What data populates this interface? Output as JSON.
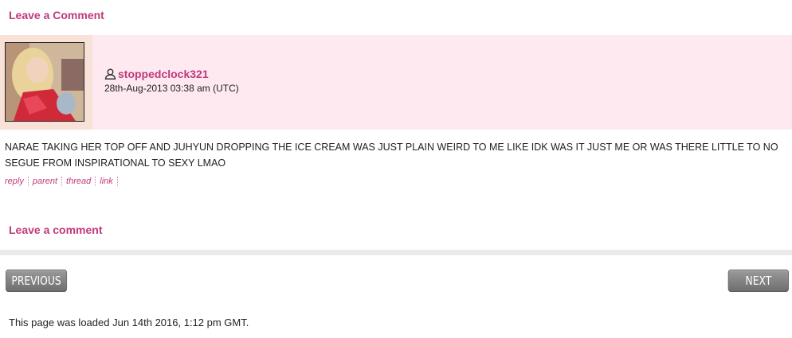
{
  "leave_comment_top": "Leave a Comment",
  "comment": {
    "username": "stoppedclock321",
    "timestamp": "28th-Aug-2013 03:38 am (UTC)",
    "body": "NARAE TAKING HER TOP OFF AND JUHYUN DROPPING THE ICE CREAM WAS JUST PLAIN WEIRD TO ME LIKE IDK WAS IT JUST ME OR WAS THERE LITTLE TO NO SEGUE FROM INSPIRATIONAL TO SEXY LMAO",
    "links": {
      "reply": "reply",
      "parent": "parent",
      "thread": "thread",
      "link": "link"
    },
    "user_icon": "user-icon",
    "header_bg": "#ffe9f1"
  },
  "leave_comment_bottom": "Leave a comment",
  "nav": {
    "previous": "PREVIOUS",
    "next": "NEXT"
  },
  "footer": {
    "loaded": "This page was loaded Jun 14th 2016, 1:12 pm GMT."
  },
  "colors": {
    "accent": "#c0397a",
    "button": "#7f7f7f"
  }
}
